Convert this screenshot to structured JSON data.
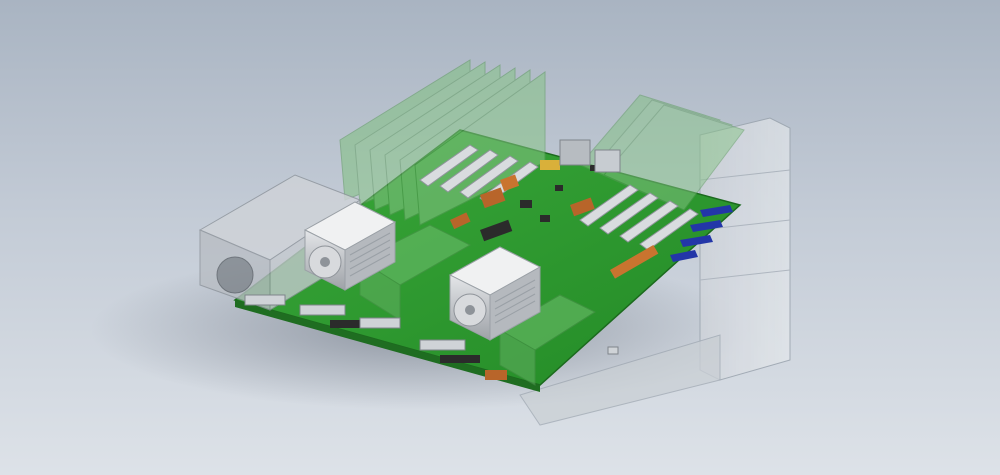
{
  "scene": {
    "subject": "motherboard-cad-render",
    "colors": {
      "background_top": "#a9b4c2",
      "background_bottom": "#dde2e8",
      "pcb": "#2f9a2f",
      "pcb_dark": "#237a24",
      "heatsink": "#c9ccd0",
      "translucent_green": "#7fbf7f",
      "translucent_gray": "#d6dade",
      "copper": "#b8652a",
      "connector_blue": "#2336a8"
    }
  }
}
